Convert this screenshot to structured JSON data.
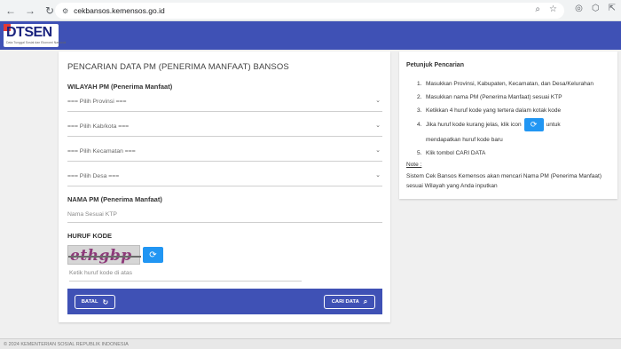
{
  "browser": {
    "url": "cekbansos.kemensos.go.id",
    "back_icon": "arrow-left-icon",
    "forward_icon": "arrow-right-icon",
    "reload_icon": "reload-icon"
  },
  "header": {
    "logo_text": "DTSEN",
    "logo_subtext": "Data Tunggal Sosial dan Ekonomi Nasional",
    "background": "#3f51b5"
  },
  "form": {
    "title": "PENCARIAN DATA PM (PENERIMA MANFAAT) BANSOS",
    "wilayah_label": "WILAYAH PM (Penerima Manfaat)",
    "provinsi": "=== Pilih Provinsi ===",
    "kabkota": "=== Pilih Kab/kota ===",
    "kecamatan": "=== Pilih Kecamatan ===",
    "desa": "=== Pilih Desa ===",
    "nama_label": "NAMA PM (Penerima Manfaat)",
    "nama_placeholder": "Nama Sesuai KTP",
    "kode_label": "HURUF KODE",
    "captcha_text": "ethgbp",
    "kode_placeholder": "Ketik huruf kode di atas",
    "batal_label": "BATAL",
    "cari_label": "CARI DATA"
  },
  "help": {
    "title": "Petunjuk Pencarian",
    "steps": [
      "Masukkan Provinsi, Kabupaten, Kecamatan, dan Desa/Kelurahan",
      "Masukkan nama PM (Penerima Manfaat) sesuai KTP",
      "Ketikkan 4 huruf kode yang tertera dalam kotak kode",
      "Jika huruf kode kurang jelas, klik icon",
      "Klik tombol CARI DATA"
    ],
    "step4_suffix": "untuk",
    "step4_continued": "mendapatkan huruf kode baru",
    "note_label": "Note :",
    "note_text": "Sistem Cek Bansos Kemensos akan mencari Nama PM (Penerima Manfaat) sesuai Wilayah yang Anda inputkan"
  },
  "footer": {
    "text": "© 2024 KEMENTERIAN SOSIAL REPUBLIK INDONESIA"
  }
}
